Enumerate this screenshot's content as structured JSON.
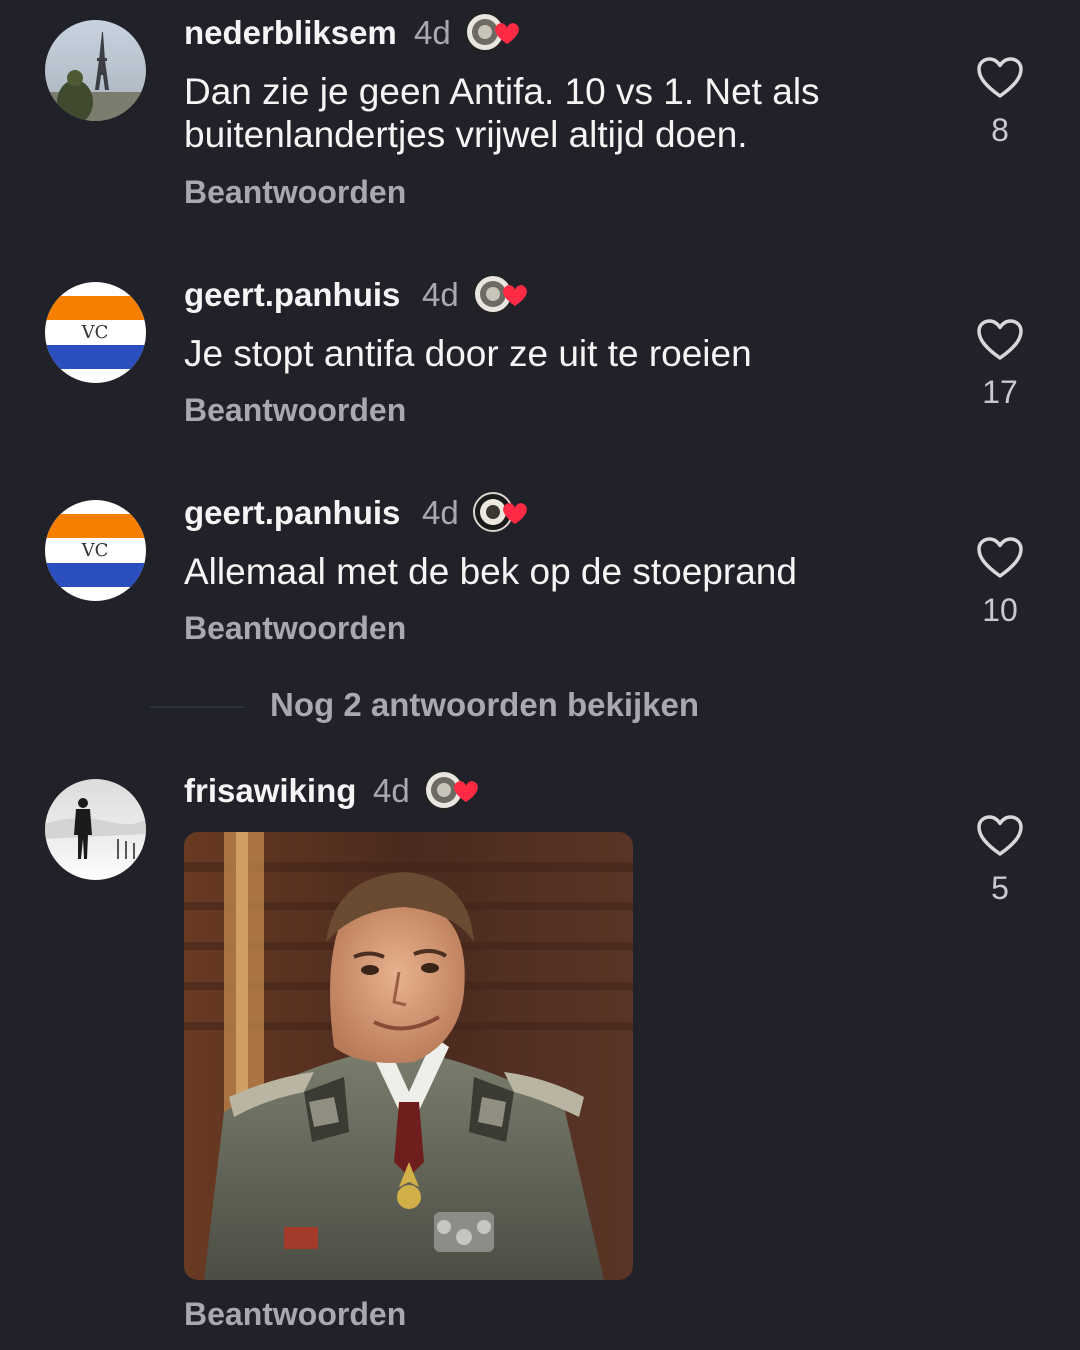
{
  "comments": [
    {
      "username": "nederbliksem",
      "time": "4d",
      "text": "Dan zie je geen Antifa. 10 vs 1. Net als buitenlandertjes vrijwel altijd doen.",
      "reply_label": "Beantwoorden",
      "likes": "8",
      "avatar": "eiffel-tower-photo"
    },
    {
      "username": "geert.panhuis",
      "time": "4d",
      "text": "Je stopt antifa door ze uit te roeien",
      "reply_label": "Beantwoorden",
      "likes": "17",
      "avatar": "orange-white-blue-flag"
    },
    {
      "username": "geert.panhuis",
      "time": "4d",
      "text": "Allemaal met de bek op de stoeprand",
      "reply_label": "Beantwoorden",
      "likes": "10",
      "avatar": "orange-white-blue-flag"
    },
    {
      "username": "frisawiking",
      "time": "4d",
      "text": "",
      "media": "gif",
      "reply_label": "Beantwoorden",
      "likes": "5",
      "avatar": "man-in-snow-photo"
    }
  ],
  "more_replies_label": "Nog 2 antwoorden bekijken",
  "colors": {
    "background": "#212229",
    "primary_text": "#f5f5f5",
    "secondary_text": "#a8a8b0",
    "heart_badge": "#ff2b45",
    "flag_orange": "#f77f00",
    "flag_blue": "#2b4fbf"
  },
  "icons": {
    "like": "heart-outline-icon",
    "badge": "seal-heart-badge-icon"
  }
}
